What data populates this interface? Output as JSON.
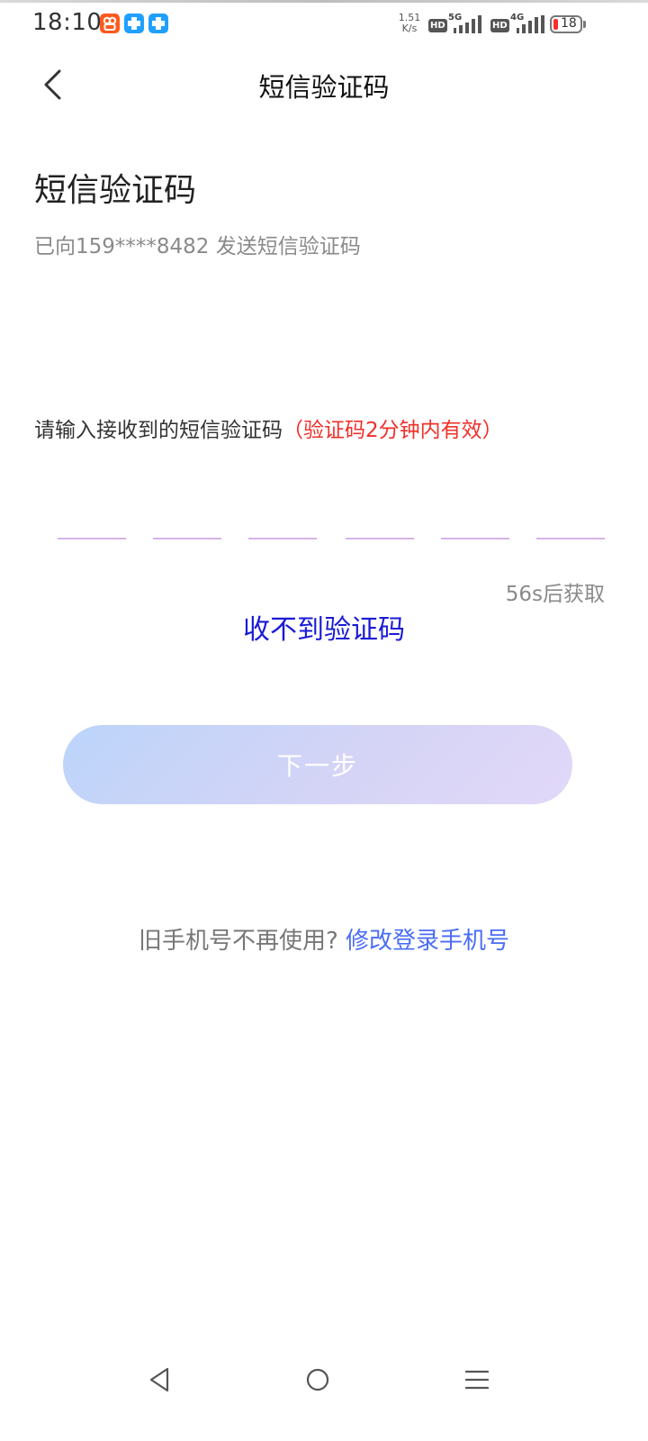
{
  "status_bar": {
    "time": "18:10",
    "net_speed_value": "1.51",
    "net_speed_unit": "K/s",
    "sim1_tag": "HD",
    "sim1_gen": "5G",
    "sim2_tag": "HD",
    "sim2_gen": "4G",
    "battery_level": "18",
    "battery_color": "#ff2d2d"
  },
  "header": {
    "title": "短信验证码",
    "back_icon": "chevron-left-icon"
  },
  "main": {
    "section_title": "短信验证码",
    "sent_info": "已向159****8482 发送短信验证码",
    "prompt": "请输入接收到的短信验证码",
    "validity_note": "（验证码2分钟内有效）",
    "validity_color": "#f0302a",
    "code_slots": [
      "",
      "",
      "",
      "",
      "",
      ""
    ],
    "countdown": "56s后获取",
    "no_code_link": "收不到验证码",
    "next_button": "下一步",
    "old_phone_question": "旧手机号不再使用?",
    "change_phone_link": "修改登录手机号",
    "link_color": "#4a6cf7"
  },
  "nav_bar": {
    "back_icon": "nav-back-icon",
    "home_icon": "nav-home-icon",
    "menu_icon": "nav-menu-icon"
  }
}
